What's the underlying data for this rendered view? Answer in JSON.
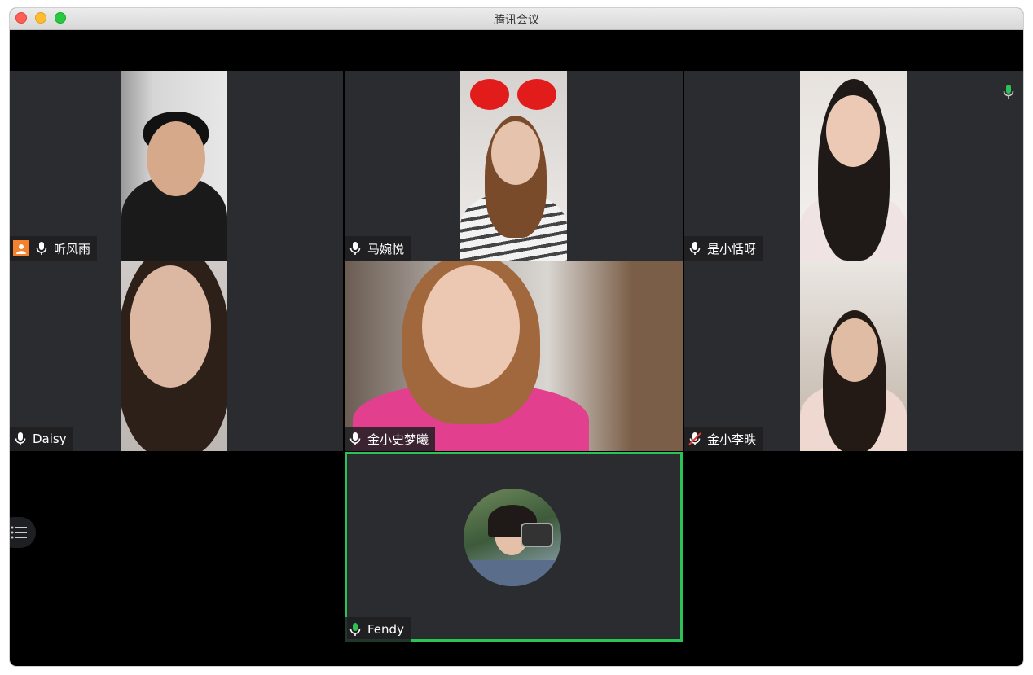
{
  "window": {
    "title": "腾讯会议"
  },
  "colors": {
    "accent_green": "#2bc256",
    "tile_bg": "#2b2c30",
    "avatar_badge": "#f4812d"
  },
  "participants": [
    {
      "name": "听风雨",
      "mic": "on",
      "avatar_badge": true
    },
    {
      "name": "马婉悦",
      "mic": "on"
    },
    {
      "name": "是小恬呀",
      "mic": "on"
    },
    {
      "name": "Daisy",
      "mic": "on"
    },
    {
      "name": "金小史梦曦",
      "mic": "on"
    },
    {
      "name": "金小李昳",
      "mic": "muted"
    },
    {
      "name": "Fendy",
      "mic": "speaking",
      "selected": true
    }
  ],
  "icons": {
    "mic": "microphone-icon",
    "mic_muted": "microphone-muted-icon",
    "side": "microphone-icon",
    "list": "list-icon",
    "avatar": "user-avatar-icon"
  }
}
